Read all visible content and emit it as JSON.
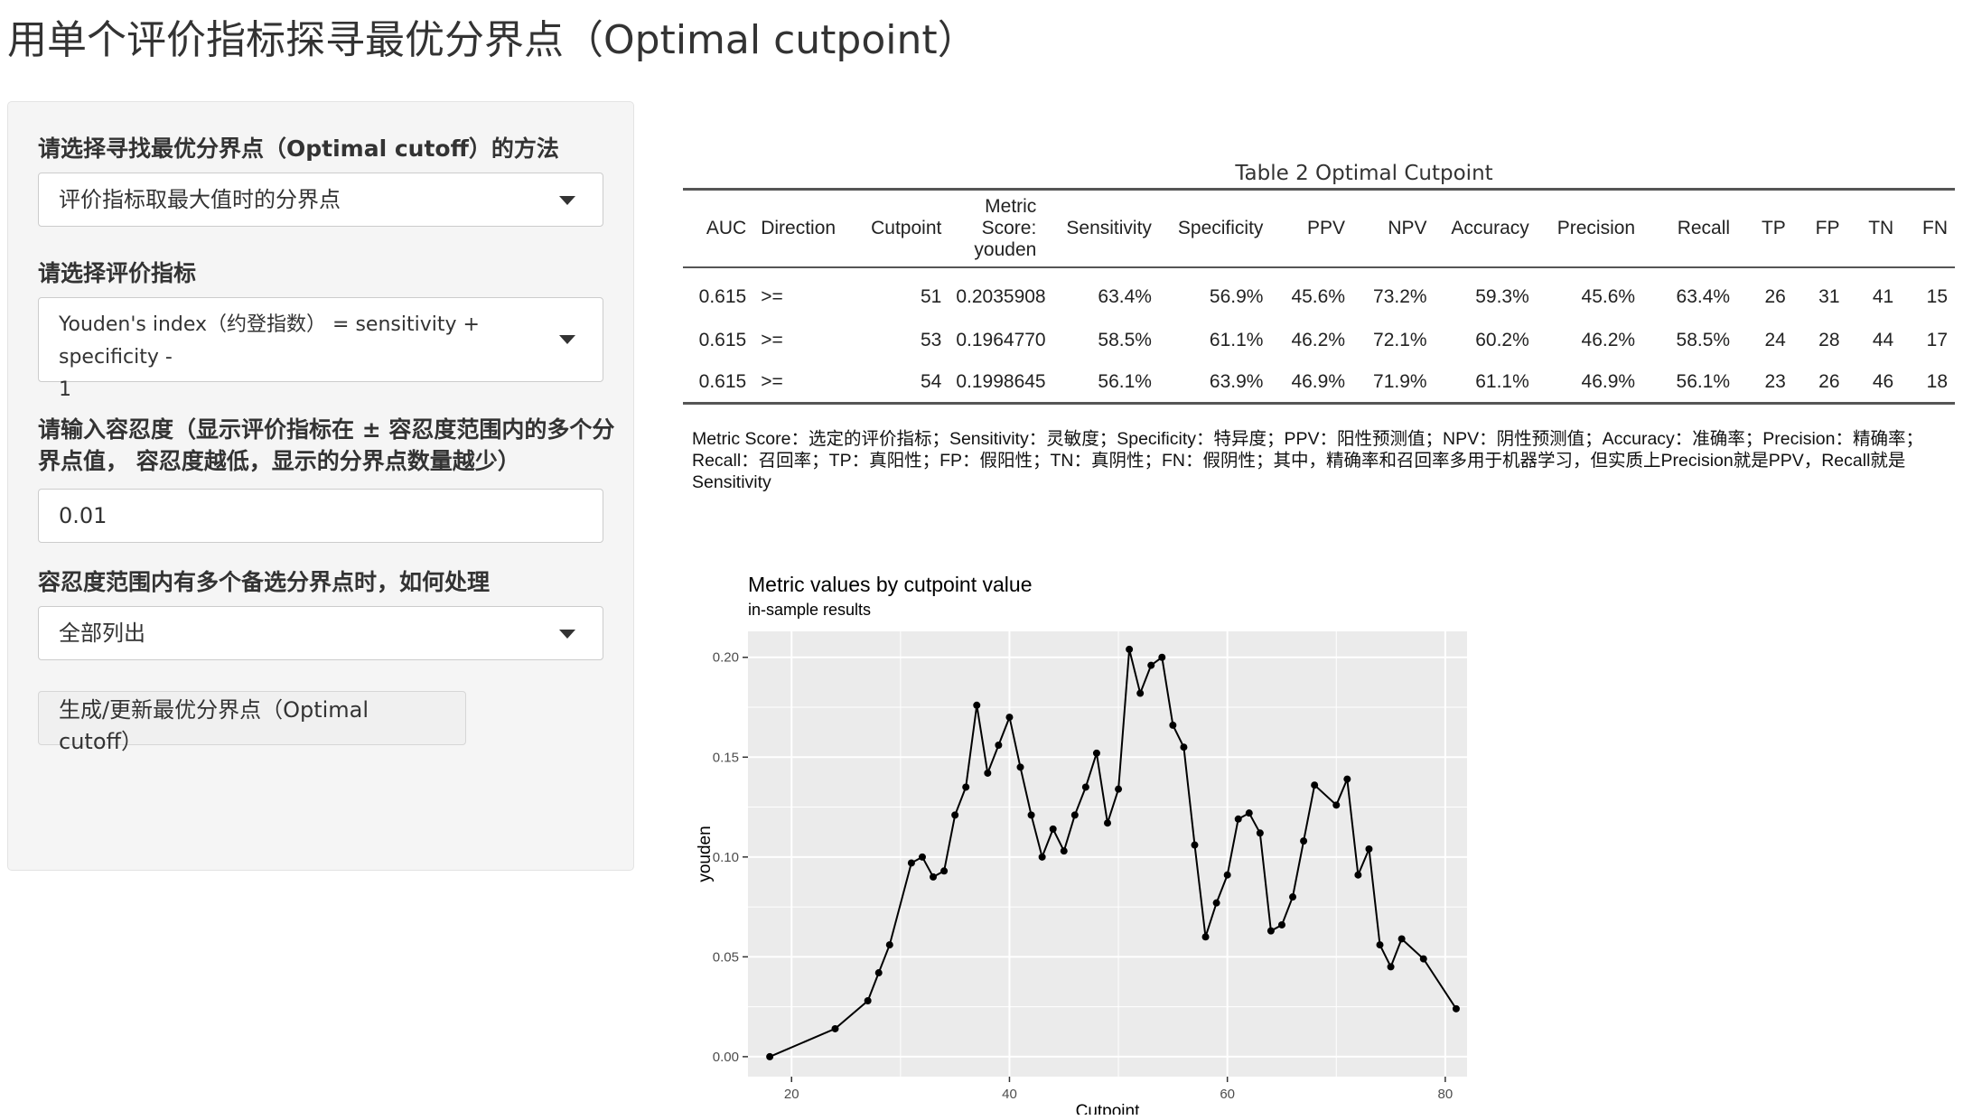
{
  "page_title": "用单个评价指标探寻最优分界点（Optimal cutpoint）",
  "sidebar": {
    "method_label": "请选择寻找最优分界点（Optimal cutoff）的方法",
    "method_value": "评价指标取最大值时的分界点",
    "metric_label": "请选择评价指标",
    "metric_value_line1": "Youden's index（约登指数） = sensitivity + specificity -",
    "metric_value_line2": "1",
    "tolerance_label_line1": "请输入容忍度（显示评价指标在 ± 容忍度范围内的多个分",
    "tolerance_label_line2": "界点值， 容忍度越低，显示的分界点数量越少）",
    "tolerance_value": "0.01",
    "multi_label": "容忍度范围内有多个备选分界点时，如何处理",
    "multi_value": "全部列出",
    "generate_button": "生成/更新最优分界点（Optimal cutoff）"
  },
  "table": {
    "caption": "Table 2 Optimal Cutpoint",
    "headers": [
      "AUC",
      "Direction",
      "Cutpoint",
      "Metric Score: youden",
      "Sensitivity",
      "Specificity",
      "PPV",
      "NPV",
      "Accuracy",
      "Precision",
      "Recall",
      "TP",
      "FP",
      "TN",
      "FN"
    ],
    "header_metric_lines": [
      "Metric",
      "Score:",
      "youden"
    ],
    "rows": [
      [
        "0.615",
        ">=",
        "51",
        "0.2035908",
        "63.4%",
        "56.9%",
        "45.6%",
        "73.2%",
        "59.3%",
        "45.6%",
        "63.4%",
        "26",
        "31",
        "41",
        "15"
      ],
      [
        "0.615",
        ">=",
        "53",
        "0.1964770",
        "58.5%",
        "61.1%",
        "46.2%",
        "72.1%",
        "60.2%",
        "46.2%",
        "58.5%",
        "24",
        "28",
        "44",
        "17"
      ],
      [
        "0.615",
        ">=",
        "54",
        "0.1998645",
        "56.1%",
        "63.9%",
        "46.9%",
        "71.9%",
        "61.1%",
        "46.9%",
        "56.1%",
        "23",
        "26",
        "46",
        "18"
      ]
    ],
    "footnote": "Metric Score：选定的评价指标；Sensitivity：灵敏度；Specificity：特异度；PPV：阳性预测值；NPV：阴性预测值；Accuracy：准确率；Precision：精确率；Recall：召回率；TP：真阳性；FP：假阳性；TN：真阴性；FN：假阴性；其中，精确率和召回率多用于机器学习，但实质上Precision就是PPV，Recall就是Sensitivity"
  },
  "chart_data": {
    "type": "line",
    "title": "Metric values by cutpoint value",
    "subtitle": "in-sample results",
    "xlabel": "Cutpoint",
    "ylabel": "youden",
    "xlim": [
      16,
      82
    ],
    "ylim": [
      -0.01,
      0.213
    ],
    "xticks": [
      20,
      40,
      60,
      80
    ],
    "yticks": [
      0.0,
      0.05,
      0.1,
      0.15,
      0.2
    ],
    "ytick_labels": [
      "0.00",
      "0.05",
      "0.10",
      "0.15",
      "0.20"
    ],
    "grid": true,
    "colors": {
      "panel": "#ebebeb",
      "grid": "#ffffff",
      "line": "#000000"
    },
    "points": [
      [
        18,
        0.0
      ],
      [
        24,
        0.014
      ],
      [
        27,
        0.028
      ],
      [
        28,
        0.042
      ],
      [
        29,
        0.056
      ],
      [
        31,
        0.097
      ],
      [
        32,
        0.1
      ],
      [
        33,
        0.09
      ],
      [
        34,
        0.093
      ],
      [
        35,
        0.121
      ],
      [
        36,
        0.135
      ],
      [
        37,
        0.176
      ],
      [
        38,
        0.142
      ],
      [
        39,
        0.156
      ],
      [
        40,
        0.17
      ],
      [
        41,
        0.145
      ],
      [
        42,
        0.121
      ],
      [
        43,
        0.1
      ],
      [
        44,
        0.114
      ],
      [
        45,
        0.103
      ],
      [
        46,
        0.121
      ],
      [
        47,
        0.135
      ],
      [
        48,
        0.152
      ],
      [
        49,
        0.117
      ],
      [
        50,
        0.134
      ],
      [
        51,
        0.204
      ],
      [
        52,
        0.182
      ],
      [
        53,
        0.196
      ],
      [
        54,
        0.2
      ],
      [
        55,
        0.166
      ],
      [
        56,
        0.155
      ],
      [
        57,
        0.106
      ],
      [
        58,
        0.06
      ],
      [
        59,
        0.077
      ],
      [
        60,
        0.091
      ],
      [
        61,
        0.119
      ],
      [
        62,
        0.122
      ],
      [
        63,
        0.112
      ],
      [
        64,
        0.063
      ],
      [
        65,
        0.066
      ],
      [
        66,
        0.08
      ],
      [
        67,
        0.108
      ],
      [
        68,
        0.136
      ],
      [
        70,
        0.126
      ],
      [
        71,
        0.139
      ],
      [
        72,
        0.091
      ],
      [
        73,
        0.104
      ],
      [
        74,
        0.056
      ],
      [
        75,
        0.045
      ],
      [
        76,
        0.059
      ],
      [
        78,
        0.049
      ],
      [
        81,
        0.024
      ]
    ]
  }
}
